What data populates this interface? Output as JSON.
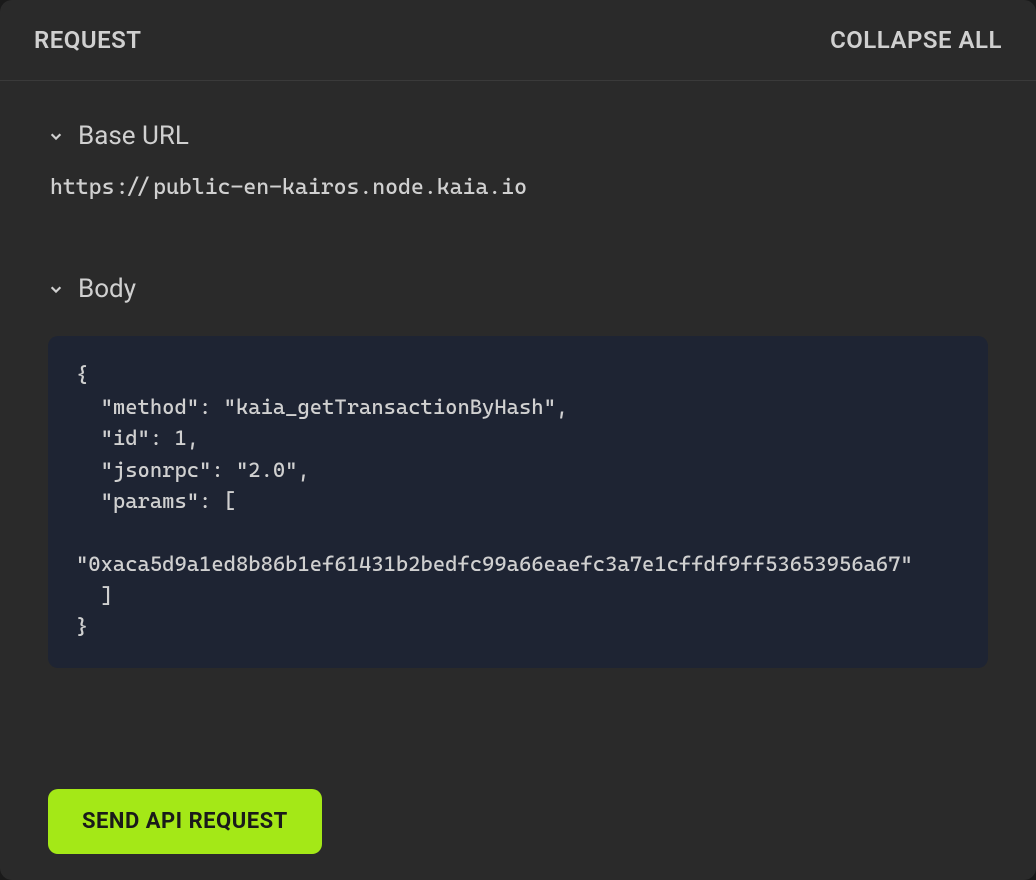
{
  "header": {
    "title": "REQUEST",
    "collapse_label": "COLLAPSE ALL"
  },
  "sections": {
    "base_url": {
      "title": "Base URL",
      "value": "https://public-en-kairos.node.kaia.io"
    },
    "body": {
      "title": "Body",
      "code": "{\n  \"method\": \"kaia_getTransactionByHash\",\n  \"id\": 1,\n  \"jsonrpc\": \"2.0\",\n  \"params\": [\n\n\"0xaca5d9a1ed8b86b1ef61431b2bedfc99a66eaefc3a7e1cffdf9ff53653956a67\"\n  ]\n}"
    }
  },
  "actions": {
    "send_label": "SEND API REQUEST"
  }
}
